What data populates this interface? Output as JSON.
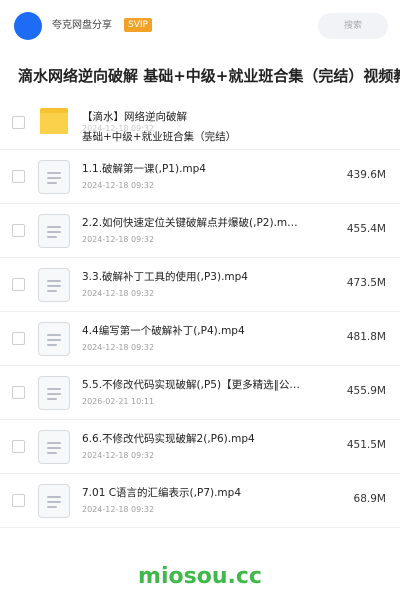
{
  "header": {
    "share_name": "夸克网盘分享",
    "badge": "SVIP",
    "search_placeholder": "搜索"
  },
  "title": "滴水网络逆向破解 基础+中级+就业班合集（完结）视频教",
  "folder": {
    "name_line1": "【滴水】网络逆向破解",
    "name_line2": "基础+中级+就业班合集（完结）",
    "date": "2024-12-18 09:32"
  },
  "files": [
    {
      "name": "1.1.破解第一课(,P1).mp4",
      "date": "2024-12-18 09:32",
      "size": "439.6M"
    },
    {
      "name": "2.2.如何快速定位关键破解点并爆破(,P2).m…",
      "date": "2024-12-18 09:32",
      "size": "455.4M"
    },
    {
      "name": "3.3.破解补丁工具的使用(,P3).mp4",
      "date": "2024-12-18 09:32",
      "size": "473.5M"
    },
    {
      "name": "4.4编写第一个破解补丁(,P4).mp4",
      "date": "2024-12-18 09:32",
      "size": "481.8M"
    },
    {
      "name": "5.5.不修改代码实现破解(,P5)【更多精选‖公…",
      "date": "2026-02-21 10:11",
      "size": "455.9M"
    },
    {
      "name": "6.6.不修改代码实现破解2(,P6).mp4",
      "date": "2024-12-18 09:32",
      "size": "451.5M"
    },
    {
      "name": "7.01 C语言的汇编表示(,P7).mp4",
      "date": "2024-12-18 09:32",
      "size": "68.9M"
    }
  ],
  "watermark": "miosou.cc",
  "colors": {
    "accent": "#1e6cf5",
    "badge": "#f4a128",
    "folder": "#fbd04a",
    "watermark": "#3fb94a"
  },
  "icons": {
    "avatar": "avatar",
    "folder": "folder-icon",
    "file": "video-file-icon"
  }
}
